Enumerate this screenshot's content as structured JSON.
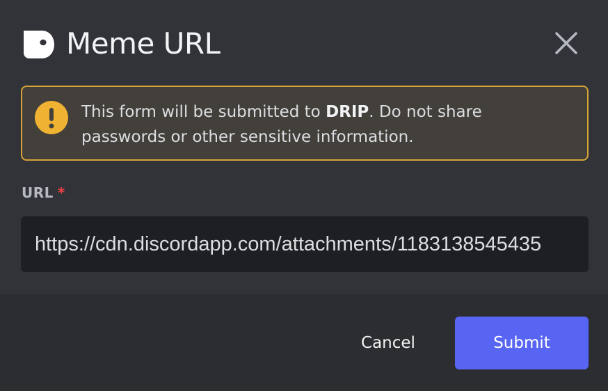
{
  "modal": {
    "app_icon": "app-logo-icon",
    "title": "Meme URL",
    "close_icon": "close-icon"
  },
  "warning": {
    "icon": "warning-icon",
    "text_before": "This form will be submitted to ",
    "app_name": "DRIP",
    "text_after": ". Do not share passwords or other sensitive information."
  },
  "form": {
    "url_label": "URL",
    "required_marker": "*",
    "url_value": "https://cdn.discordapp.com/attachments/1183138545435"
  },
  "footer": {
    "cancel_label": "Cancel",
    "submit_label": "Submit"
  },
  "colors": {
    "background": "#313338",
    "footer_background": "#2b2d31",
    "warning_border": "#d5a336",
    "warning_background": "#43403b",
    "input_background": "#1e1f22",
    "submit_background": "#5865f2",
    "required": "#f23f42"
  }
}
